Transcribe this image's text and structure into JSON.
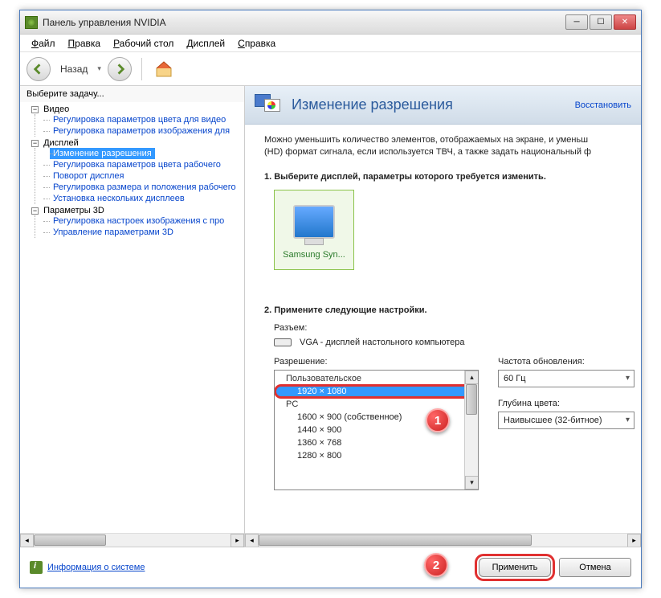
{
  "window": {
    "title": "Панель управления NVIDIA"
  },
  "menu": {
    "file": "Файл",
    "edit": "Правка",
    "desktop": "Рабочий стол",
    "display": "Дисплей",
    "help": "Справка"
  },
  "toolbar": {
    "back": "Назад"
  },
  "sidebar": {
    "title": "Выберите задачу...",
    "groups": [
      {
        "label": "Видео",
        "items": [
          "Регулировка параметров цвета для видео",
          "Регулировка параметров изображения для"
        ]
      },
      {
        "label": "Дисплей",
        "items": [
          "Изменение разрешения",
          "Регулировка параметров цвета рабочего",
          "Поворот дисплея",
          "Регулировка размера и положения рабочего",
          "Установка нескольких дисплеев"
        ]
      },
      {
        "label": "Параметры 3D",
        "items": [
          "Регулировка настроек изображения с про",
          "Управление параметрами 3D"
        ]
      }
    ],
    "selected": "Изменение разрешения"
  },
  "main": {
    "title": "Изменение разрешения",
    "restore": "Восстановить",
    "desc1": "Можно уменьшить количество элементов, отображаемых на экране, и уменьш",
    "desc2": "(HD) формат сигнала, если используется ТВЧ, а также задать национальный ф",
    "step1": "1. Выберите дисплей, параметры которого требуется изменить.",
    "display_name": "Samsung Syn...",
    "step2": "2. Примените следующие настройки.",
    "connector_label": "Разъем:",
    "connector_value": "VGA - дисплей настольного компьютера",
    "resolution_label": "Разрешение:",
    "res_groups": [
      "Пользовательское",
      "PC"
    ],
    "res_items_custom": [
      "1920 × 1080"
    ],
    "res_items_pc": [
      "1600 × 900 (собственное)",
      "1440 × 900",
      "1360 × 768",
      "1280 × 800"
    ],
    "res_selected": "1920 × 1080",
    "refresh_label": "Частота обновления:",
    "refresh_value": "60 Гц",
    "depth_label": "Глубина цвета:",
    "depth_value": "Наивысшее (32-битное)"
  },
  "footer": {
    "sysinfo": "Информация о системе",
    "apply": "Применить",
    "cancel": "Отмена"
  },
  "callouts": {
    "one": "1",
    "two": "2"
  }
}
